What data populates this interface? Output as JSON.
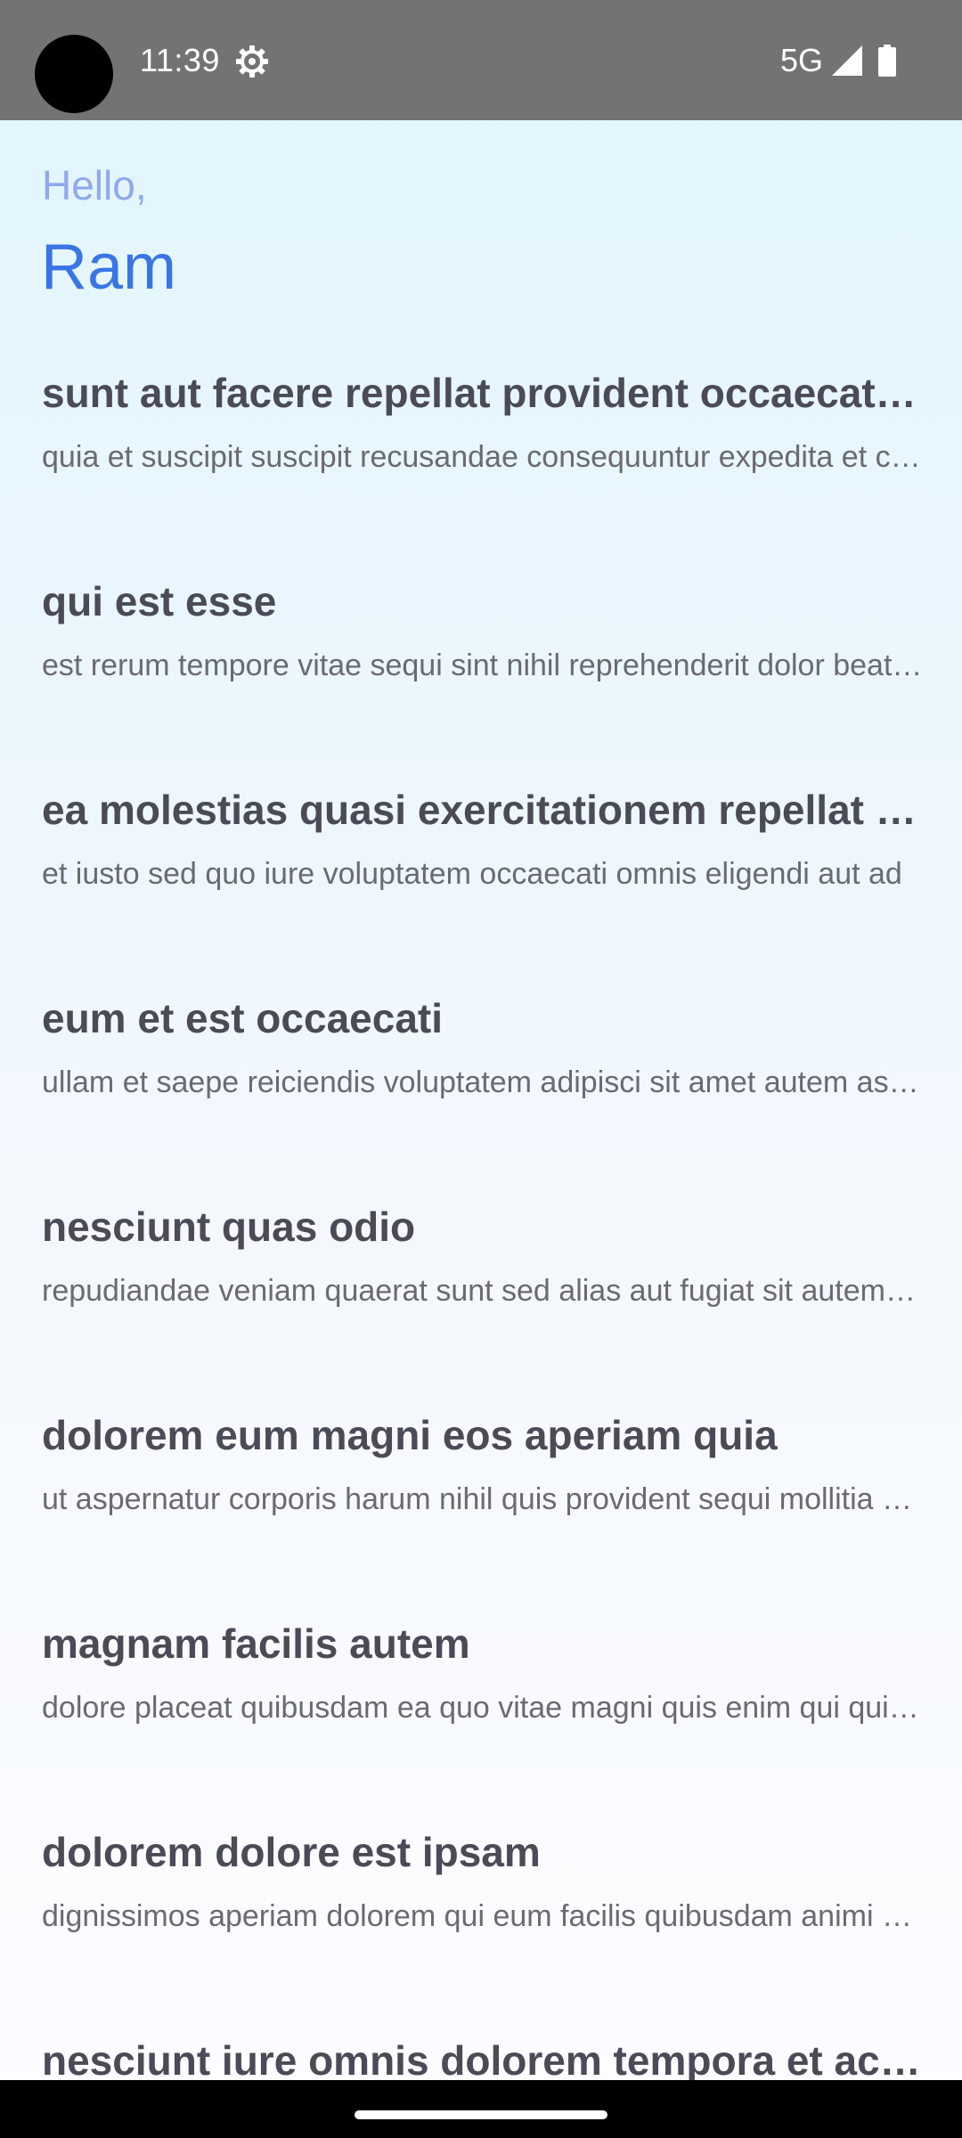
{
  "status_bar": {
    "time": "11:39",
    "network": "5G",
    "icons": [
      "settings-icon",
      "signal-icon",
      "battery-icon"
    ]
  },
  "header": {
    "greeting": "Hello,",
    "name": "Ram"
  },
  "posts": [
    {
      "title": "sunt aut facere repellat provident occaecati excepturi optio reprehenderit",
      "body": "quia et suscipit suscipit recusandae consequuntur expedita et cum reprehenderit molestiae ut ut quas totam"
    },
    {
      "title": "qui est esse",
      "body": "est rerum tempore vitae sequi sint nihil reprehenderit dolor beatae ea dolores neque"
    },
    {
      "title": "ea molestias quasi exercitationem repellat qui ipsa sit aut",
      "body": "et iusto sed quo iure voluptatem occaecati omnis eligendi aut ad"
    },
    {
      "title": "eum et est occaecati",
      "body": "ullam et saepe reiciendis voluptatem adipisci sit amet autem assumenda provident rerum culpa"
    },
    {
      "title": "nesciunt quas odio",
      "body": "repudiandae veniam quaerat sunt sed alias aut fugiat sit autem sed est"
    },
    {
      "title": "dolorem eum magni eos aperiam quia",
      "body": "ut aspernatur corporis harum nihil quis provident sequi mollitia nobis aliquid molestiae"
    },
    {
      "title": "magnam facilis autem",
      "body": "dolore placeat quibusdam ea quo vitae magni quis enim qui quis quo nemo aut saepe"
    },
    {
      "title": "dolorem dolore est ipsam",
      "body": "dignissimos aperiam dolorem qui eum facilis quibusdam animi sint suscipit qui sint possimus cum"
    },
    {
      "title": "nesciunt iure omnis dolorem tempora et accusantium",
      "body": ""
    }
  ],
  "colors": {
    "status_bar": "#737373",
    "greeting": "#8fa9ef",
    "name": "#3a75e6",
    "title": "#4b4b58",
    "body": "#6a6a72"
  }
}
